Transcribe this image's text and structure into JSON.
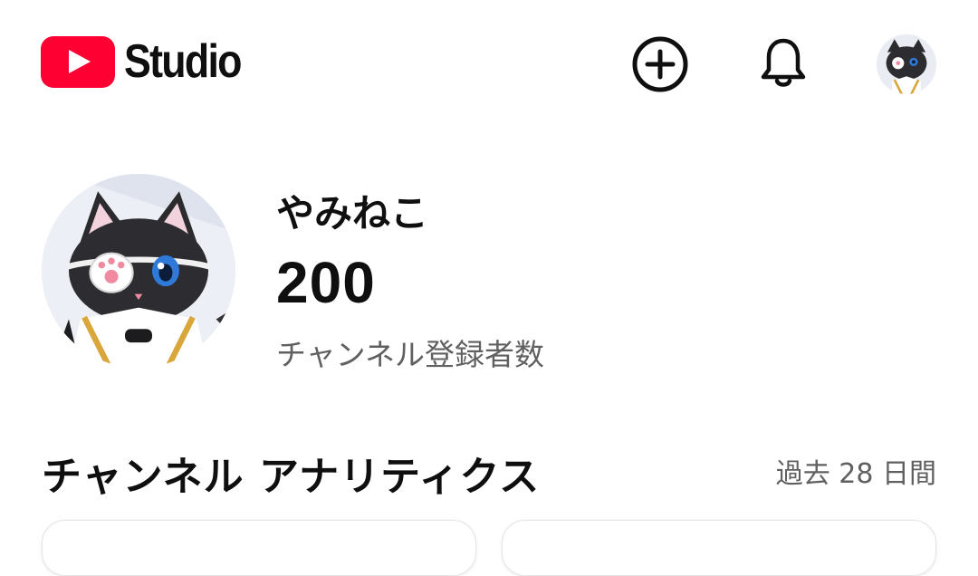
{
  "header": {
    "logo_text": "Studio",
    "icons": [
      "youtube-logo-icon",
      "create-icon",
      "bell-icon",
      "avatar"
    ]
  },
  "channel": {
    "name": "やみねこ",
    "subscriber_count": "200",
    "subscriber_label": "チャンネル登録者数"
  },
  "analytics": {
    "title": "チャンネル アナリティクス",
    "period": "過去 28 日間"
  },
  "colors": {
    "brand_red": "#ff0033",
    "text_primary": "#0f0f0f",
    "text_secondary": "#606060"
  }
}
